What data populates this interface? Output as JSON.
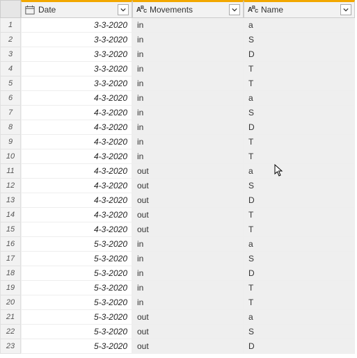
{
  "columns": {
    "date": {
      "label": "Date",
      "type": "date"
    },
    "movements": {
      "label": "Movements",
      "type": "text"
    },
    "name": {
      "label": "Name",
      "type": "text"
    }
  },
  "rows": [
    {
      "n": "1",
      "date": "3-3-2020",
      "movements": "in",
      "name": "a"
    },
    {
      "n": "2",
      "date": "3-3-2020",
      "movements": "in",
      "name": "S"
    },
    {
      "n": "3",
      "date": "3-3-2020",
      "movements": "in",
      "name": "D"
    },
    {
      "n": "4",
      "date": "3-3-2020",
      "movements": "in",
      "name": "T"
    },
    {
      "n": "5",
      "date": "3-3-2020",
      "movements": "in",
      "name": "T"
    },
    {
      "n": "6",
      "date": "4-3-2020",
      "movements": "in",
      "name": "a"
    },
    {
      "n": "7",
      "date": "4-3-2020",
      "movements": "in",
      "name": "S"
    },
    {
      "n": "8",
      "date": "4-3-2020",
      "movements": "in",
      "name": "D"
    },
    {
      "n": "9",
      "date": "4-3-2020",
      "movements": "in",
      "name": "T"
    },
    {
      "n": "10",
      "date": "4-3-2020",
      "movements": "in",
      "name": "T"
    },
    {
      "n": "11",
      "date": "4-3-2020",
      "movements": "out",
      "name": "a"
    },
    {
      "n": "12",
      "date": "4-3-2020",
      "movements": "out",
      "name": "S"
    },
    {
      "n": "13",
      "date": "4-3-2020",
      "movements": "out",
      "name": "D"
    },
    {
      "n": "14",
      "date": "4-3-2020",
      "movements": "out",
      "name": "T"
    },
    {
      "n": "15",
      "date": "4-3-2020",
      "movements": "out",
      "name": "T"
    },
    {
      "n": "16",
      "date": "5-3-2020",
      "movements": "in",
      "name": "a"
    },
    {
      "n": "17",
      "date": "5-3-2020",
      "movements": "in",
      "name": "S"
    },
    {
      "n": "18",
      "date": "5-3-2020",
      "movements": "in",
      "name": "D"
    },
    {
      "n": "19",
      "date": "5-3-2020",
      "movements": "in",
      "name": "T"
    },
    {
      "n": "20",
      "date": "5-3-2020",
      "movements": "in",
      "name": "T"
    },
    {
      "n": "21",
      "date": "5-3-2020",
      "movements": "out",
      "name": "a"
    },
    {
      "n": "22",
      "date": "5-3-2020",
      "movements": "out",
      "name": "S"
    },
    {
      "n": "23",
      "date": "5-3-2020",
      "movements": "out",
      "name": "D"
    }
  ]
}
